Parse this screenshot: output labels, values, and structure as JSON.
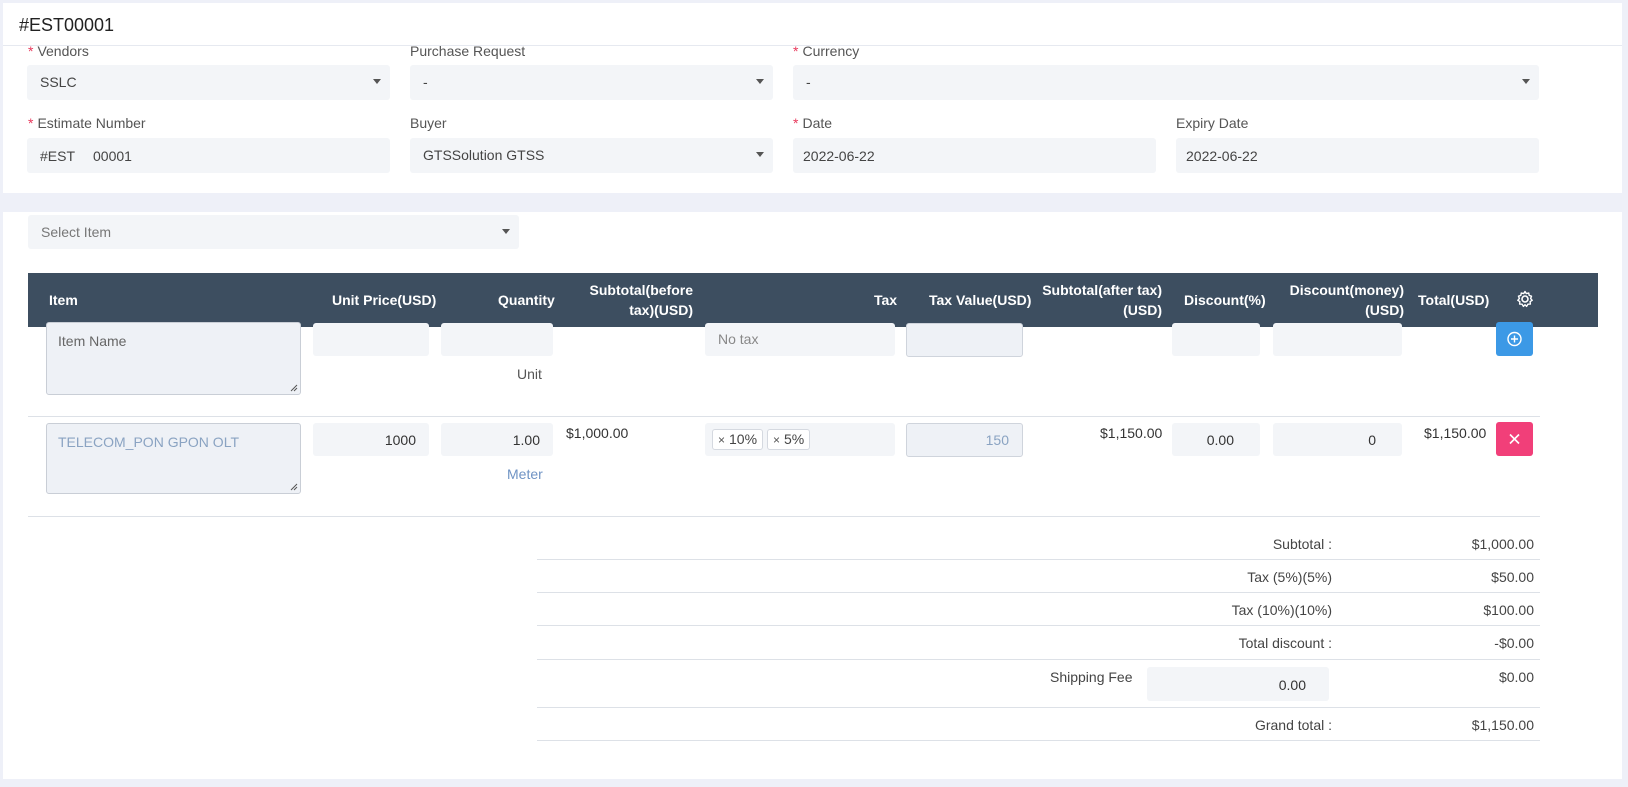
{
  "estimate": {
    "title": "#EST00001"
  },
  "form": {
    "vendors": {
      "label": "Vendors",
      "value": "SSLC"
    },
    "purchase_request": {
      "label": "Purchase Request",
      "value": "-"
    },
    "currency": {
      "label": "Currency",
      "value": "-"
    },
    "estimate_number": {
      "label": "Estimate Number",
      "prefix": "#EST",
      "value": "00001"
    },
    "buyer": {
      "label": "Buyer",
      "value": "GTSSolution GTSS"
    },
    "date": {
      "label": "Date",
      "value": "2022-06-22"
    },
    "expiry_date": {
      "label": "Expiry Date",
      "value": "2022-06-22"
    },
    "required_mark": "*"
  },
  "items": {
    "select_placeholder": "Select Item",
    "columns": {
      "item": "Item",
      "unit_price": "Unit Price(USD)",
      "quantity": "Quantity",
      "subtotal_before_l1": "Subtotal(before",
      "subtotal_before_l2": "tax)(USD)",
      "tax": "Tax",
      "tax_value": "Tax Value(USD)",
      "subtotal_after_l1": "Subtotal(after tax)",
      "subtotal_after_l2": "(USD)",
      "discount_pct": "Discount(%)",
      "discount_money_l1": "Discount(money)",
      "discount_money_l2": "(USD)",
      "total": "Total(USD)"
    },
    "new_row": {
      "item_placeholder": "Item Name",
      "unit": "Unit",
      "tax_placeholder": "No tax"
    },
    "rows": [
      {
        "item": "TELECOM_PON GPON OLT",
        "unit_price": "1000",
        "quantity": "1.00",
        "unit": "Meter",
        "subtotal_before": "$1,000.00",
        "taxes": [
          "10%",
          "5%"
        ],
        "tax_value": "150",
        "subtotal_after": "$1,150.00",
        "discount_pct": "0.00",
        "discount_money": "0",
        "total": "$1,150.00"
      }
    ]
  },
  "summary": {
    "subtotal_label": "Subtotal :",
    "subtotal_value": "$1,000.00",
    "tax5_label": "Tax (5%)(5%)",
    "tax5_value": "$50.00",
    "tax10_label": "Tax (10%)(10%)",
    "tax10_value": "$100.00",
    "discount_label": "Total discount :",
    "discount_value": "-$0.00",
    "shipping_label": "Shipping Fee",
    "shipping_input": "0.00",
    "shipping_value": "$0.00",
    "grand_label": "Grand total :",
    "grand_value": "$1,150.00"
  },
  "colors": {
    "header_bg": "#3d4e60",
    "add_button": "#3c99e6",
    "remove_button": "#f13f79",
    "required": "#e8395c",
    "item_text": "#8aa3c2"
  },
  "icons": {
    "settings": "gear-icon",
    "add": "plus-circle-icon",
    "remove": "close-icon"
  }
}
